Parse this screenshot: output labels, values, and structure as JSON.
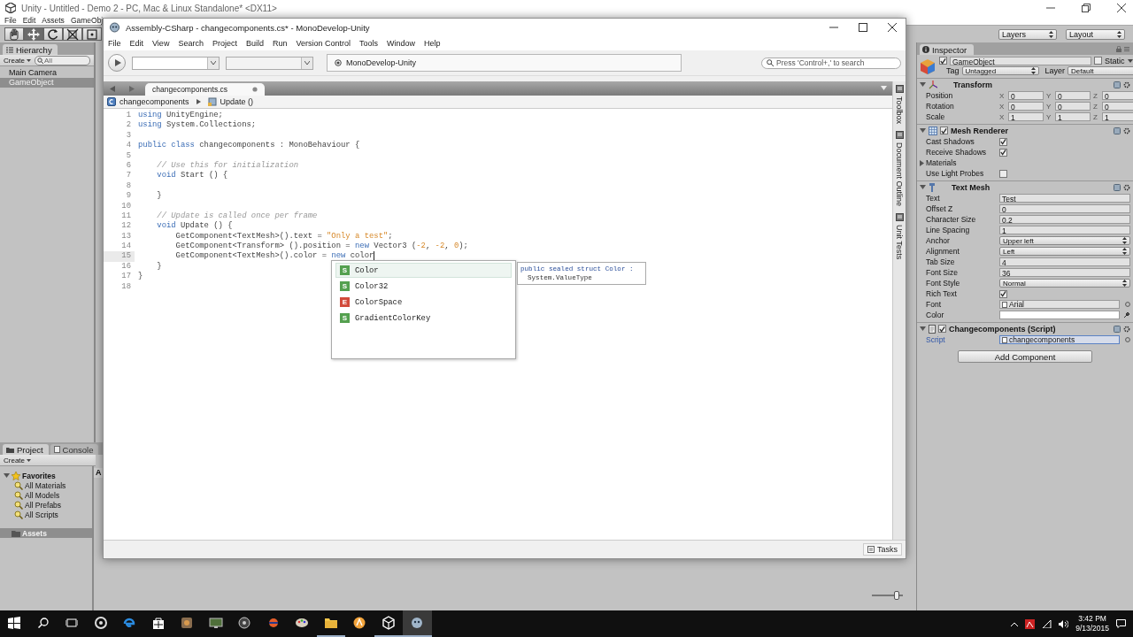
{
  "unity": {
    "title": "Unity - Untitled - Demo 2 - PC, Mac & Linux Standalone* <DX11>",
    "menu": [
      "File",
      "Edit",
      "Assets",
      "GameObj"
    ],
    "tools": [
      {
        "selected": false
      },
      {
        "selected": true
      },
      {
        "selected": false
      },
      {
        "selected": false
      },
      {
        "selected": false
      }
    ],
    "layers": "Layers",
    "layout": "Layout",
    "hierarchy": {
      "tab": "Hierarchy",
      "create": "Create",
      "search_placeholder": "All",
      "items": [
        {
          "label": "Main Camera",
          "selected": false
        },
        {
          "label": "GameObject",
          "selected": true
        }
      ]
    },
    "project": {
      "tabs": [
        {
          "label": "Project",
          "selected": true
        },
        {
          "label": "Console",
          "selected": false
        }
      ],
      "create": "Create",
      "column_header": "A",
      "tree": [
        {
          "label": "Favorites",
          "selected": false,
          "expanded": true,
          "children": [
            {
              "label": "All Materials",
              "selected": false
            },
            {
              "label": "All Models",
              "selected": false
            },
            {
              "label": "All Prefabs",
              "selected": false
            },
            {
              "label": "All Scripts",
              "selected": false
            }
          ]
        },
        {
          "label": "Assets",
          "selected": true
        }
      ]
    },
    "view_slider": {
      "level": 0.8
    },
    "inspector": {
      "tab": "Inspector",
      "object": {
        "active": true,
        "name": "GameObject",
        "static": false,
        "static_label": "Static",
        "tag_label": "Tag",
        "tag": "Untagged",
        "layer_label": "Layer",
        "layer": "Default"
      },
      "components": [
        {
          "kind": "transform",
          "title": "Transform",
          "expanded": true,
          "rows": [
            {
              "kind": "vector",
              "label": "Position",
              "axes": [
                {
                  "axis": "X",
                  "value": "0"
                },
                {
                  "axis": "Y",
                  "value": "0"
                },
                {
                  "axis": "Z",
                  "value": "0"
                }
              ]
            },
            {
              "kind": "vector",
              "label": "Rotation",
              "axes": [
                {
                  "axis": "X",
                  "value": "0"
                },
                {
                  "axis": "Y",
                  "value": "0"
                },
                {
                  "axis": "Z",
                  "value": "0"
                }
              ]
            },
            {
              "kind": "vector",
              "label": "Scale",
              "axes": [
                {
                  "axis": "X",
                  "value": "1"
                },
                {
                  "axis": "Y",
                  "value": "1"
                },
                {
                  "axis": "Z",
                  "value": "1"
                }
              ]
            }
          ]
        },
        {
          "kind": "mesh_renderer",
          "title": "Mesh Renderer",
          "enabled": true,
          "expanded": true,
          "rows": [
            {
              "kind": "checkbox",
              "label": "Cast Shadows",
              "checked": true
            },
            {
              "kind": "checkbox",
              "label": "Receive Shadows",
              "checked": true
            },
            {
              "kind": "foldout",
              "label": "Materials",
              "expanded": false
            },
            {
              "kind": "checkbox",
              "label": "Use Light Probes",
              "checked": false
            }
          ]
        },
        {
          "kind": "text_mesh",
          "title": "Text Mesh",
          "expanded": true,
          "rows": [
            {
              "kind": "text",
              "label": "Text",
              "value": "Test"
            },
            {
              "kind": "text",
              "label": "Offset Z",
              "value": "0"
            },
            {
              "kind": "text",
              "label": "Character Size",
              "value": "0.2"
            },
            {
              "kind": "text",
              "label": "Line Spacing",
              "value": "1"
            },
            {
              "kind": "dropdown",
              "label": "Anchor",
              "value": "Upper left"
            },
            {
              "kind": "dropdown",
              "label": "Alignment",
              "value": "Left"
            },
            {
              "kind": "text",
              "label": "Tab Size",
              "value": "4"
            },
            {
              "kind": "text",
              "label": "Font Size",
              "value": "36"
            },
            {
              "kind": "dropdown",
              "label": "Font Style",
              "value": "Normal"
            },
            {
              "kind": "checkbox",
              "label": "Rich Text",
              "checked": true
            },
            {
              "kind": "object",
              "label": "Font",
              "value": "Arial"
            },
            {
              "kind": "color",
              "label": "Color",
              "color": "#ffffff"
            }
          ]
        },
        {
          "kind": "script",
          "title": "Changecomponents (Script)",
          "enabled": true,
          "expanded": true,
          "rows": [
            {
              "kind": "script",
              "label": "Script",
              "value": "changecomponents"
            }
          ]
        }
      ],
      "add_component": "Add Component"
    }
  },
  "monodevelop": {
    "title": "Assembly-CSharp - changecomponents.cs* - MonoDevelop-Unity",
    "menu": [
      "File",
      "Edit",
      "View",
      "Search",
      "Project",
      "Build",
      "Run",
      "Version Control",
      "Tools",
      "Window",
      "Help"
    ],
    "status": "MonoDevelop-Unity",
    "search_placeholder": "Press 'Control+,' to search",
    "tabs": [
      {
        "label": "changecomponents.cs",
        "selected": true
      }
    ],
    "breadcrumb": [
      {
        "kind": "class",
        "label": "changecomponents"
      },
      {
        "kind": "method",
        "label": "Update ()"
      }
    ],
    "lines": [
      {
        "number": "1",
        "current": false,
        "tokens": [
          {
            "kind": "keyword",
            "text": "using"
          },
          {
            "kind": "plain",
            "text": " UnityEngine;"
          }
        ]
      },
      {
        "number": "2",
        "current": false,
        "tokens": [
          {
            "kind": "keyword",
            "text": "using"
          },
          {
            "kind": "plain",
            "text": " System.Collections;"
          }
        ]
      },
      {
        "number": "3",
        "current": false
      },
      {
        "number": "4",
        "current": false,
        "tokens": [
          {
            "kind": "keyword",
            "text": "public"
          },
          {
            "kind": "keyword",
            "text": " class"
          },
          {
            "kind": "plain",
            "text": " changecomponents : MonoBehaviour {"
          }
        ]
      },
      {
        "number": "5",
        "current": false
      },
      {
        "number": "6",
        "current": false,
        "tokens": [
          {
            "kind": "comment",
            "text": "    // Use this for initialization"
          }
        ]
      },
      {
        "number": "7",
        "current": false,
        "tokens": [
          {
            "kind": "keyword",
            "text": "    void"
          },
          {
            "kind": "plain",
            "text": " Start () {"
          }
        ]
      },
      {
        "number": "8",
        "current": false
      },
      {
        "number": "9",
        "current": false,
        "tokens": [
          {
            "kind": "plain",
            "text": "    }"
          }
        ]
      },
      {
        "number": "10",
        "current": false
      },
      {
        "number": "11",
        "current": false,
        "tokens": [
          {
            "kind": "comment",
            "text": "    // Update is called once per frame"
          }
        ]
      },
      {
        "number": "12",
        "current": false,
        "tokens": [
          {
            "kind": "keyword",
            "text": "    void"
          },
          {
            "kind": "plain",
            "text": " Update () {"
          }
        ]
      },
      {
        "number": "13",
        "current": false,
        "tokens": [
          {
            "kind": "plain",
            "text": "        GetComponent<TextMesh>().text = "
          },
          {
            "kind": "string",
            "text": "\"Only a test\""
          },
          {
            "kind": "plain",
            "text": ";"
          }
        ]
      },
      {
        "number": "14",
        "current": false,
        "tokens": [
          {
            "kind": "plain",
            "text": "        GetComponent<Transform> ().position = "
          },
          {
            "kind": "keyword",
            "text": "new"
          },
          {
            "kind": "plain",
            "text": " Vector3 ("
          },
          {
            "kind": "number",
            "text": "-2"
          },
          {
            "kind": "plain",
            "text": ", "
          },
          {
            "kind": "number",
            "text": "-2"
          },
          {
            "kind": "plain",
            "text": ", "
          },
          {
            "kind": "number",
            "text": "0"
          },
          {
            "kind": "plain",
            "text": ");"
          }
        ]
      },
      {
        "number": "15",
        "current": true,
        "tokens": [
          {
            "kind": "plain",
            "text": "        GetComponent<TextMesh>().color = "
          },
          {
            "kind": "keyword",
            "text": "new"
          },
          {
            "kind": "plain",
            "text": " color"
          }
        ]
      },
      {
        "number": "16",
        "current": false,
        "tokens": [
          {
            "kind": "plain",
            "text": "    }"
          }
        ]
      },
      {
        "number": "17",
        "current": false,
        "tokens": [
          {
            "kind": "plain",
            "text": "}"
          }
        ]
      },
      {
        "number": "18",
        "current": false
      }
    ],
    "completion": {
      "items": [
        {
          "kind": "struct",
          "badge": "S",
          "label": "Color",
          "selected": true
        },
        {
          "kind": "struct",
          "badge": "S",
          "label": "Color32",
          "selected": false
        },
        {
          "kind": "enum",
          "badge": "E",
          "label": "ColorSpace",
          "selected": false
        },
        {
          "kind": "struct",
          "badge": "S",
          "label": "GradientColorKey",
          "selected": false
        }
      ],
      "tooltip": [
        "public sealed struct Color :",
        "System.ValueType"
      ]
    },
    "side_pads": [
      "Toolbox",
      "Document Outline",
      "Unit Tests"
    ],
    "status_button": "Tasks"
  },
  "taskbar": {
    "apps": [
      {
        "running": false,
        "selected": false
      },
      {
        "running": false,
        "selected": false
      },
      {
        "running": false,
        "selected": false
      },
      {
        "running": false,
        "selected": false
      },
      {
        "running": false,
        "selected": false
      },
      {
        "running": false,
        "selected": false
      },
      {
        "running": false,
        "selected": false
      },
      {
        "running": false,
        "selected": false
      },
      {
        "running": true,
        "selected": false
      },
      {
        "running": false,
        "selected": false
      },
      {
        "running": true,
        "selected": false
      },
      {
        "running": true,
        "selected": true
      }
    ],
    "time": "3:42 PM",
    "date": "9/13/2015"
  }
}
